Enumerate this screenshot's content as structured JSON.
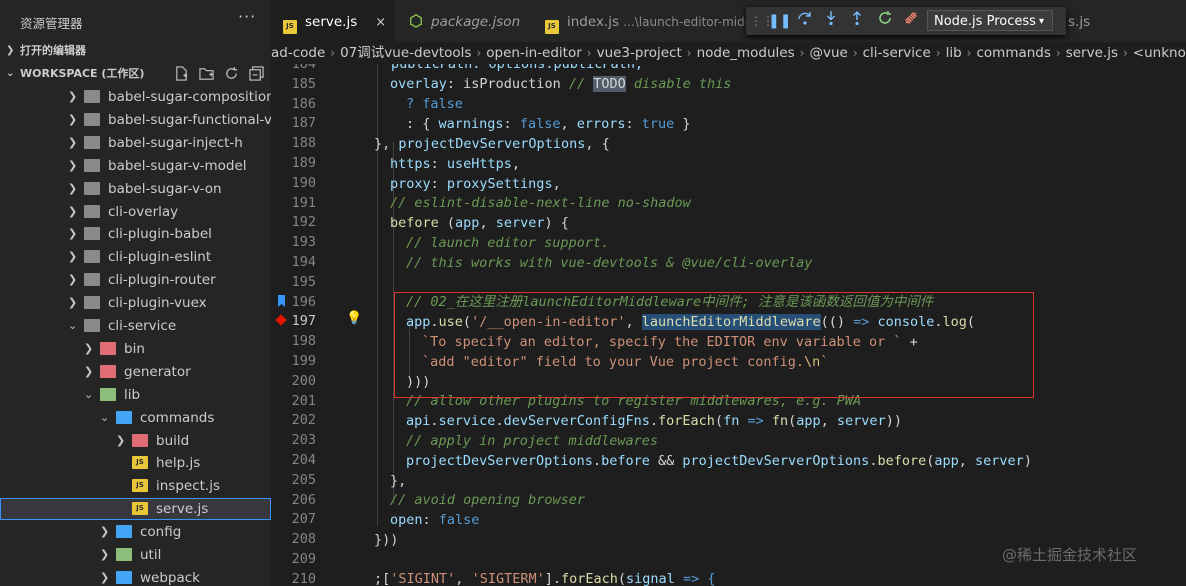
{
  "sidebar": {
    "title": "资源管理器",
    "more_icon": "ellipsis-icon",
    "open_editors_label": "打开的编辑器",
    "workspace_label": "WORKSPACE (工作区)",
    "tree": [
      {
        "label": "babel-sugar-composition-api-render-instance",
        "expanded": false,
        "type": "folder",
        "color": "grey"
      },
      {
        "label": "babel-sugar-functional-vue",
        "expanded": false,
        "type": "folder",
        "color": "grey"
      },
      {
        "label": "babel-sugar-inject-h",
        "expanded": false,
        "type": "folder",
        "color": "grey"
      },
      {
        "label": "babel-sugar-v-model",
        "expanded": false,
        "type": "folder",
        "color": "grey"
      },
      {
        "label": "babel-sugar-v-on",
        "expanded": false,
        "type": "folder",
        "color": "grey"
      },
      {
        "label": "cli-overlay",
        "expanded": false,
        "type": "folder",
        "color": "grey"
      },
      {
        "label": "cli-plugin-babel",
        "expanded": false,
        "type": "folder",
        "color": "grey"
      },
      {
        "label": "cli-plugin-eslint",
        "expanded": false,
        "type": "folder",
        "color": "grey"
      },
      {
        "label": "cli-plugin-router",
        "expanded": false,
        "type": "folder",
        "color": "grey"
      },
      {
        "label": "cli-plugin-vuex",
        "expanded": false,
        "type": "folder",
        "color": "grey"
      },
      {
        "label": "cli-service",
        "expanded": true,
        "type": "folder",
        "color": "grey"
      },
      {
        "label": "bin",
        "expanded": false,
        "type": "folder",
        "color": "red"
      },
      {
        "label": "generator",
        "expanded": false,
        "type": "folder",
        "color": "red"
      },
      {
        "label": "lib",
        "expanded": true,
        "type": "folder",
        "color": "green"
      },
      {
        "label": "commands",
        "expanded": true,
        "type": "folder",
        "color": "blue"
      },
      {
        "label": "build",
        "expanded": false,
        "type": "folder",
        "color": "red"
      },
      {
        "label": "help.js",
        "type": "js"
      },
      {
        "label": "inspect.js",
        "type": "js"
      },
      {
        "label": "serve.js",
        "type": "js",
        "selected": true
      },
      {
        "label": "config",
        "expanded": false,
        "type": "folder",
        "color": "blue"
      },
      {
        "label": "util",
        "expanded": false,
        "type": "folder",
        "color": "green"
      },
      {
        "label": "webpack",
        "expanded": false,
        "type": "folder",
        "color": "blue"
      }
    ]
  },
  "tabs": [
    {
      "label": "serve.js",
      "icon": "js-file-icon",
      "active": true,
      "close": "×"
    },
    {
      "label": "package.json",
      "icon": "node-json-icon",
      "italic": true
    },
    {
      "label": "index.js",
      "hint": "...\\launch-editor-middle",
      "icon": "js-file-icon"
    },
    {
      "label": "s.js",
      "icon": "js-file-icon"
    }
  ],
  "debug": {
    "process_label": "Node.js Process"
  },
  "breadcrumb": [
    "ad-code",
    "07调试vue-devtools",
    "open-in-editor",
    "vue3-project",
    "node_modules",
    "@vue",
    "cli-service",
    "lib",
    "commands",
    "serve.js",
    "<unknown>"
  ],
  "editor": {
    "line_numbers": [
      "184",
      "185",
      "186",
      "187",
      "188",
      "189",
      "190",
      "191",
      "192",
      "193",
      "194",
      "195",
      "196",
      "197",
      "198",
      "199",
      "200",
      "201",
      "202",
      "203",
      "204",
      "205",
      "206",
      "207",
      "208",
      "209",
      "210"
    ],
    "current_line": "197",
    "t": {
      "l184": "publicPath: options.publicPath,",
      "l185a": "overlay",
      "l185b": ": isProduction ",
      "l185c": "// ",
      "l185d": "TODO",
      "l185e": " disable this",
      "l186a": "? ",
      "l186b": "false",
      "l187a": ": { ",
      "l187b": "warnings",
      "l187c": ": ",
      "l187d": "false",
      "l187e": ", ",
      "l187f": "errors",
      "l187g": ": ",
      "l187h": "true",
      "l187i": " }",
      "l188a": "}, ",
      "l188b": "projectDevServerOptions",
      "l188c": ", {",
      "l189a": "https",
      "l189b": ": ",
      "l189c": "useHttps",
      "l189d": ",",
      "l190a": "proxy",
      "l190b": ": ",
      "l190c": "proxySettings",
      "l190d": ",",
      "l191": "// eslint-disable-next-line no-shadow",
      "l192a": "before",
      "l192b": " (",
      "l192c": "app",
      "l192d": ", ",
      "l192e": "server",
      "l192f": ") {",
      "l193": "// launch editor support.",
      "l194": "// this works with vue-devtools & @vue/cli-overlay",
      "l196": "// 02_在这里注册launchEditorMiddleware中间件; 注意是该函数返回值为中间件",
      "l197a": "app",
      "l197b": ".",
      "l197c": "use",
      "l197d": "(",
      "l197e": "'/__open-in-editor'",
      "l197f": ", ",
      "l197g": "launchEditorMiddleware",
      "l197h": "(() ",
      "l197i": "=>",
      "l197j": " console",
      "l197k": ".",
      "l197l": "log",
      "l197m": "(",
      "l198a": "`To specify an editor, specify the EDITOR env variable or `",
      "l198b": " +",
      "l199a": "`add \"editor\" field to your Vue project config.",
      "l199b": "\\n",
      "l199c": "`",
      "l200": ")))",
      "l201": "// allow other plugins to register middlewares, e.g. PWA",
      "l202a": "api",
      "l202b": ".",
      "l202c": "service",
      "l202d": ".",
      "l202e": "devServerConfigFns",
      "l202f": ".",
      "l202g": "forEach",
      "l202h": "(",
      "l202i": "fn",
      "l202j": " => ",
      "l202k": "fn",
      "l202l": "(",
      "l202m": "app",
      "l202n": ", ",
      "l202o": "server",
      "l202p": "))",
      "l203": "// apply in project middlewares",
      "l204a": "projectDevServerOptions",
      "l204b": ".",
      "l204c": "before",
      "l204d": " && ",
      "l204e": "projectDevServerOptions",
      "l204f": ".",
      "l204g": "before",
      "l204h": "(",
      "l204i": "app",
      "l204j": ", ",
      "l204k": "server",
      "l204l": ")",
      "l205": "},",
      "l206": "// avoid opening browser",
      "l207a": "open",
      "l207b": ": ",
      "l207c": "false",
      "l208": "}))",
      "l210a": ";[",
      "l210b": "'SIGINT'",
      "l210c": ", ",
      "l210d": "'SIGTERM'",
      "l210e": "].",
      "l210f": "forEach",
      "l210g": "(",
      "l210h": "signal",
      "l210i": " => {"
    }
  },
  "watermark": "@稀土掘金技术社区",
  "colors": {
    "accent": "#3794ff",
    "highlight_box": "#d9342b",
    "breakpoint": "#e51400"
  }
}
